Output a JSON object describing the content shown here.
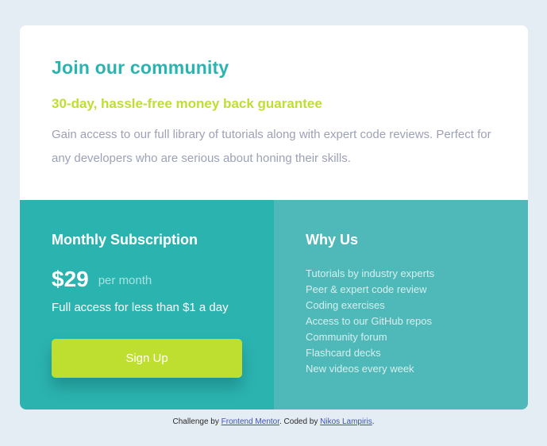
{
  "top": {
    "title": "Join our community",
    "subtitle": "30-day, hassle-free money back guarantee",
    "description": "Gain access to our full library of tutorials along with expert code reviews. Perfect for any developers who are serious about honing their skills."
  },
  "subscription": {
    "heading": "Monthly Subscription",
    "price": "$29",
    "period": "per month",
    "note": "Full access for less than $1 a day",
    "button_label": "Sign Up"
  },
  "why": {
    "heading": "Why Us",
    "items": [
      "Tutorials by industry experts",
      "Peer & expert code review",
      "Coding exercises",
      "Access to our GitHub repos",
      "Community forum",
      "Flashcard decks",
      "New videos every week"
    ]
  },
  "footer": {
    "prefix": "Challenge by ",
    "link1": "Frontend Mentor",
    "middle": ". Coded by ",
    "link2": "Nikos Lampiris",
    "suffix": "."
  },
  "colors": {
    "page_background": "#e5edf4",
    "primary_teal": "#2bb3b0",
    "secondary_teal": "#4fb8b8",
    "lime": "#bfdf30",
    "gray_text": "#9da1b5"
  }
}
